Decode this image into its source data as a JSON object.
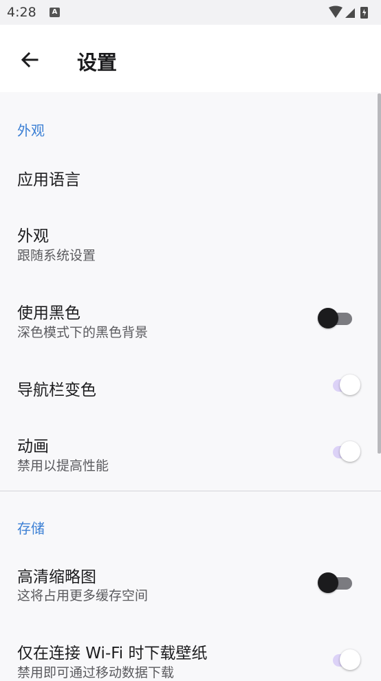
{
  "status_bar": {
    "time": "4:28",
    "notification_glyph": "A"
  },
  "app_bar": {
    "title": "设置"
  },
  "sections": [
    {
      "header": "外观",
      "items": [
        {
          "title": "应用语言"
        },
        {
          "title": "外观",
          "subtitle": "跟随系统设置"
        },
        {
          "title": "使用黑色",
          "subtitle": "深色模式下的黑色背景",
          "toggle": false
        },
        {
          "title": "导航栏变色",
          "toggle": true
        },
        {
          "title": "动画",
          "subtitle": "禁用以提高性能",
          "toggle": true
        }
      ]
    },
    {
      "header": "存储",
      "items": [
        {
          "title": "高清缩略图",
          "subtitle": "这将占用更多缓存空间",
          "toggle": false
        },
        {
          "title": "仅在连接 Wi-Fi 时下载壁纸",
          "subtitle": "禁用即可通过移动数据下载",
          "toggle": true
        }
      ]
    }
  ],
  "colors": {
    "accent": "#3b7fd4",
    "switch_on_track": "#dcd2f7",
    "switch_off_thumb": "#1b1b1d"
  }
}
